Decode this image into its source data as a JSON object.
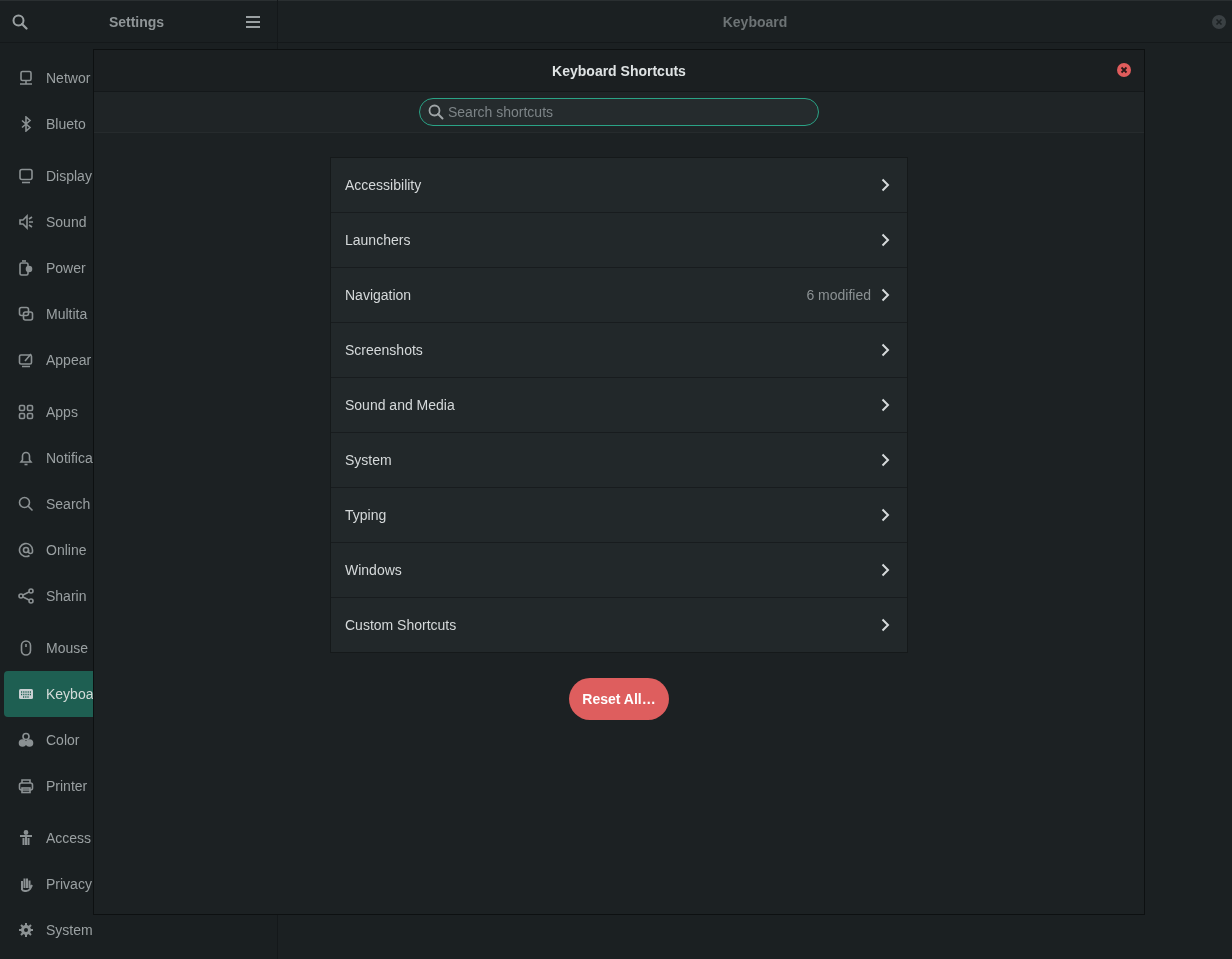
{
  "sidebar": {
    "title": "Settings",
    "items": [
      {
        "label": "Networ",
        "selected": false
      },
      {
        "label": "Blueto",
        "selected": false
      },
      {
        "label": "Display",
        "selected": false
      },
      {
        "label": "Sound",
        "selected": false
      },
      {
        "label": "Power",
        "selected": false
      },
      {
        "label": "Multita",
        "selected": false
      },
      {
        "label": "Appear",
        "selected": false
      },
      {
        "label": "Apps",
        "selected": false
      },
      {
        "label": "Notifica",
        "selected": false
      },
      {
        "label": "Search",
        "selected": false
      },
      {
        "label": "Online",
        "selected": false
      },
      {
        "label": "Sharin",
        "selected": false
      },
      {
        "label": "Mouse",
        "selected": false
      },
      {
        "label": "Keyboa",
        "selected": true
      },
      {
        "label": "Color",
        "selected": false
      },
      {
        "label": "Printer",
        "selected": false
      },
      {
        "label": "Access",
        "selected": false
      },
      {
        "label": "Privacy",
        "selected": false
      },
      {
        "label": "System",
        "selected": false
      }
    ]
  },
  "main": {
    "title": "Keyboard"
  },
  "dialog": {
    "title": "Keyboard Shortcuts",
    "search": {
      "placeholder": "Search shortcuts"
    },
    "rows": [
      {
        "label": "Accessibility"
      },
      {
        "label": "Launchers"
      },
      {
        "label": "Navigation",
        "status": "6 modified"
      },
      {
        "label": "Screenshots"
      },
      {
        "label": "Sound and Media"
      },
      {
        "label": "System"
      },
      {
        "label": "Typing"
      },
      {
        "label": "Windows"
      },
      {
        "label": "Custom Shortcuts"
      }
    ],
    "reset_button": "Reset All…"
  }
}
